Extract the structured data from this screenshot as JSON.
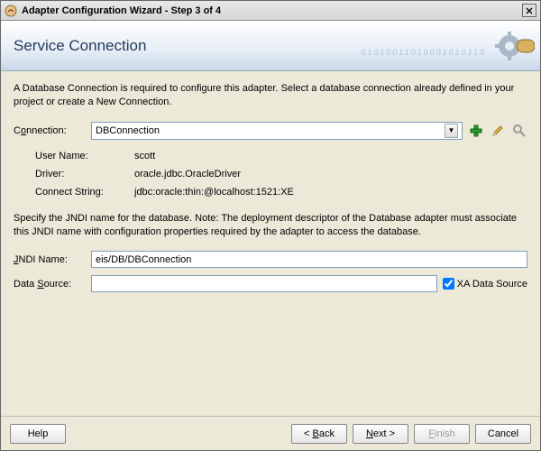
{
  "window": {
    "title": "Adapter Configuration Wizard - Step 3 of 4"
  },
  "header": {
    "title": "Service Connection",
    "numbers": "01010011010001010110"
  },
  "intro": "A Database Connection is required to configure this adapter. Select a database connection already defined in your project or create a New Connection.",
  "connection": {
    "label_pre": "C",
    "label_ul": "o",
    "label_post": "nnection:",
    "selected": "DBConnection"
  },
  "details": {
    "userName_label": "User Name:",
    "userName": "scott",
    "driver_label": "Driver:",
    "driver": "oracle.jdbc.OracleDriver",
    "connectString_label": "Connect String:",
    "connectString": "jdbc:oracle:thin:@localhost:1521:XE"
  },
  "advice": "Specify the JNDI name for the database.  Note: The deployment descriptor of the Database adapter must associate this JNDI name with configuration properties required by the adapter to access the database.",
  "jndi": {
    "label_ul": "J",
    "label_post": "NDI Name:",
    "value": "eis/DB/DBConnection"
  },
  "datasource": {
    "label_pre": "Data ",
    "label_ul": "S",
    "label_post": "ource:",
    "value": ""
  },
  "xa": {
    "label_ul": "X",
    "label_post": "A Data Source",
    "checked": true
  },
  "footer": {
    "help": "Help",
    "back_pre": "< ",
    "back_ul": "B",
    "back_post": "ack",
    "next_ul": "N",
    "next_post": "ext >",
    "finish_ul": "F",
    "finish_post": "inish",
    "cancel": "Cancel"
  }
}
